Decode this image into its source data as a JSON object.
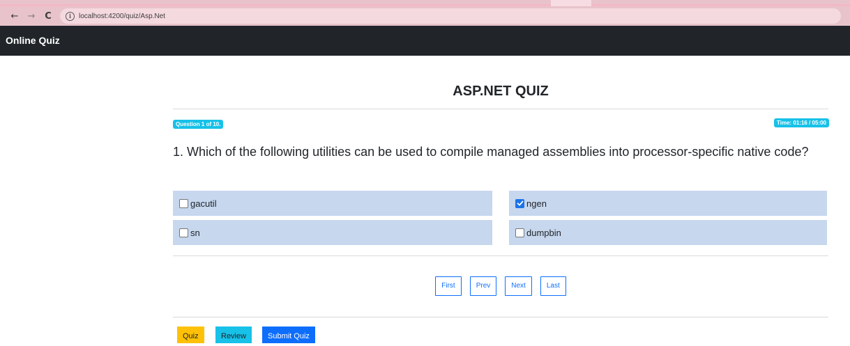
{
  "browser": {
    "url": "localhost:4200/quiz/Asp.Net",
    "back_icon": "←",
    "forward_icon": "→",
    "reload_icon": "C",
    "info_icon": "i"
  },
  "navbar": {
    "brand": "Online Quiz"
  },
  "quiz": {
    "title": "ASP.NET QUIZ",
    "question_badge": "Question 1 of 10.",
    "time_badge": "Time: 01:16 / 05:00",
    "question_text": "1. Which of the following utilities can be used to compile managed assemblies into processor-specific native code?",
    "options": [
      {
        "label": "gacutil",
        "checked": false
      },
      {
        "label": "ngen",
        "checked": true
      },
      {
        "label": "sn",
        "checked": false
      },
      {
        "label": "dumpbin",
        "checked": false
      }
    ]
  },
  "pager": {
    "first": "First",
    "prev": "Prev",
    "next": "Next",
    "last": "Last"
  },
  "actions": {
    "quiz": "Quiz",
    "review": "Review",
    "submit": "Submit Quiz"
  },
  "colors": {
    "navbar_bg": "#212529",
    "option_bg": "#c6d7ee",
    "badge_bg": "#17c1e8",
    "primary": "#0d6efd",
    "warning": "#ffc107",
    "browser_chrome": "#e8c3cb"
  }
}
